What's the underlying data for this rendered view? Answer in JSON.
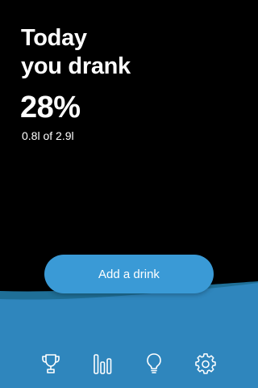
{
  "header": {
    "title_line1": "Today",
    "title_line2": "you drank"
  },
  "progress": {
    "percent_text": "28%",
    "percent_value": 0.28,
    "amount_text": "0.8l of 2.9l"
  },
  "actions": {
    "add_drink_label": "Add a drink"
  },
  "tab_bar": {
    "items": [
      {
        "name": "trophy-icon"
      },
      {
        "name": "bar-chart-icon"
      },
      {
        "name": "lightbulb-icon"
      },
      {
        "name": "gear-icon"
      }
    ]
  },
  "colors": {
    "background": "#000000",
    "water_dark": "#1f6f97",
    "water_main": "#2f86bd",
    "button": "#3a9ad6",
    "text": "#ffffff"
  }
}
